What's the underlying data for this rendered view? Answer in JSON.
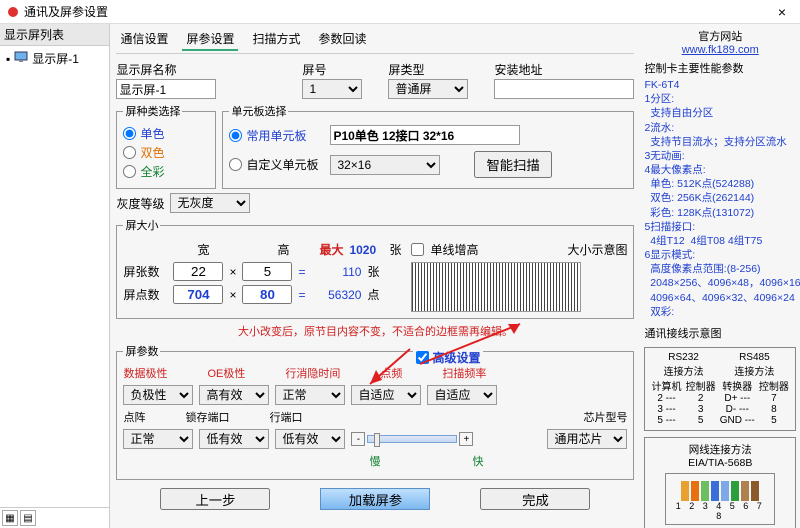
{
  "titlebar": {
    "title": "通讯及屏参设置",
    "close": "×"
  },
  "sidebar": {
    "header": "显示屏列表",
    "item1": "显示屏-1"
  },
  "tabs": {
    "t1": "通信设置",
    "t2": "屏参设置",
    "t3": "扫描方式",
    "t4": "参数回读"
  },
  "fields": {
    "nameLabel": "显示屏名称",
    "nameValue": "显示屏-1",
    "idLabel": "屏号",
    "idValue": "1",
    "typeLabel": "屏类型",
    "typeValue": "普通屏",
    "addrLabel": "安装地址",
    "addrValue": ""
  },
  "kind": {
    "legend": "屏种类选择",
    "opt1": "单色",
    "opt2": "双色",
    "opt3": "全彩"
  },
  "unit": {
    "legend": "单元板选择",
    "opt1": "常用单元板",
    "opt1Value": "P10单色 12接口 32*16",
    "opt2": "自定义单元板",
    "opt2Value": "32×16",
    "smart": "智能扫描"
  },
  "gray": {
    "label": "灰度等级",
    "value": "无灰度"
  },
  "size": {
    "legend": "屏大小",
    "width": "宽",
    "height": "高",
    "max": "最大",
    "maxVal": "1020",
    "unit": "张",
    "rows": "屏张数",
    "rowsW": "22",
    "rowsH": "5",
    "rowsRes": "110",
    "rowsUnit": "张",
    "pts": "屏点数",
    "ptsW": "704",
    "ptsH": "80",
    "ptsRes": "56320",
    "ptsUnit": "点",
    "singleLine": "单线增高",
    "previewLabel": "大小示意图"
  },
  "warn": "大小改变后，原节目内容不变，不适合的边框需再编辑。",
  "params": {
    "legend": "屏参数",
    "advanced": "高级设置",
    "h1": "数据极性",
    "h2": "OE极性",
    "h3": "行消隐时间",
    "h4": "点频",
    "h5": "扫描频率",
    "v1": "负极性",
    "v2": "高有效",
    "v3": "正常",
    "v4": "自适应",
    "v5": "自适应",
    "l1": "点阵",
    "l2": "锁存端口",
    "l3": "行端口",
    "w1": "正常",
    "w2": "低有效",
    "w3": "低有效",
    "slow": "慢",
    "fast": "快",
    "chipLabel": "芯片型号",
    "chipValue": "通用芯片"
  },
  "footer": {
    "prev": "上一步",
    "load": "加载屏参",
    "done": "完成"
  },
  "right": {
    "siteLabel": "官方网站",
    "siteUrl": "www.fk189.com",
    "cardHeader": "控制卡主要性能参数",
    "info": "FK-6T4\n1分区:\n  支持自由分区\n2流水:\n  支持节目流水；支持分区流水\n3无动画:\n4最大像素点:\n  单色: 512K点(524288)\n  双色: 256K点(262144)\n  彩色: 128K点(131072)\n5扫描接口:\n  4组T12  4组T08 4组T75\n6显示模式:\n  高度像素点范围:(8-256)\n  2048×256、4096×48，4096×16\n  4096×64、4096×32、4096×24\n  双彩:",
    "wiringHeader": "通讯接线示意图",
    "rs232": "RS232",
    "rs485": "RS485",
    "conn": "连接方法",
    "pc": "计算机",
    "ctrl": "控制器",
    "conv": "转换器",
    "r232_1a": "2 ---",
    "r232_1b": "2",
    "r232_2a": "3 ---",
    "r232_2b": "3",
    "r232_3a": "5 ---",
    "r232_3b": "5",
    "r485_1a": "D+ ---",
    "r485_1b": "7",
    "r485_2a": "D- ---",
    "r485_2b": "8",
    "r485_3a": "GND ---",
    "r485_3b": "5",
    "cableHeader": "网线连接方法",
    "cableStd": "EIA/TIA-568B",
    "pins": "1 2 3 4 5 6 7 8"
  }
}
